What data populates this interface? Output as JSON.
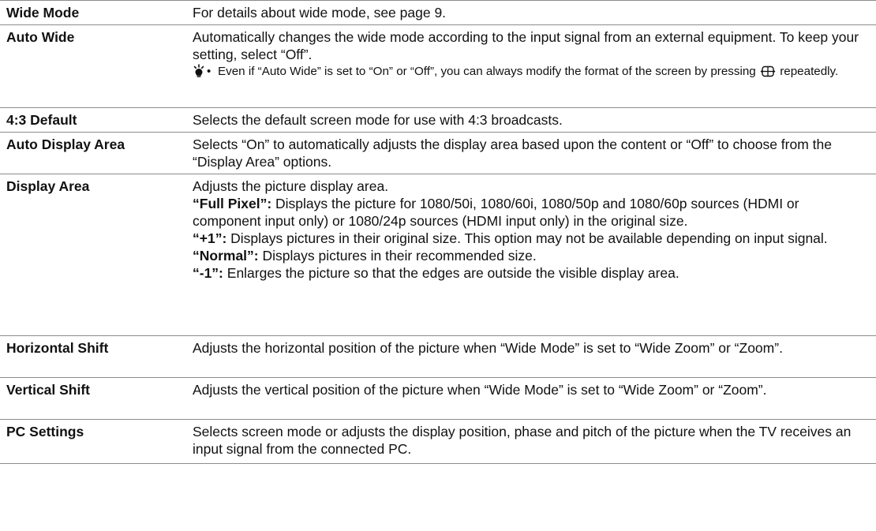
{
  "rows": [
    {
      "term": "Wide Mode",
      "text": "For details about wide mode, see page 9."
    },
    {
      "term": "Auto Wide",
      "text": "Automatically changes the wide mode according to the input signal from an external equipment. To keep your setting, select “Off”.",
      "hint_bullet": "•",
      "hint_before": "Even if “Auto Wide” is set to “On” or “Off”, you can always modify the format of the screen by pressing",
      "hint_after": "repeatedly."
    },
    {
      "term": "4:3 Default",
      "text": "Selects the default screen mode for use with 4:3 broadcasts."
    },
    {
      "term": "Auto Display Area",
      "text": "Selects “On” to automatically adjusts the display area based upon the content or “Off” to choose from the “Display Area” options."
    },
    {
      "term": "Display Area",
      "text": "Adjusts the picture display area.",
      "options": [
        {
          "label": "“Full Pixel”:",
          "text": "Displays the picture for 1080/50i, 1080/60i, 1080/50p and 1080/60p sources (HDMI or component input only) or 1080/24p sources (HDMI input only) in the original size."
        },
        {
          "label": "“+1”:",
          "text": "Displays pictures in their original size. This option may not be available depending on input signal."
        },
        {
          "label": "“Normal”:",
          "text": "Displays pictures in their recommended size."
        },
        {
          "label": "“-1”:",
          "text": "Enlarges the picture so that the edges are outside the visible display area."
        }
      ]
    },
    {
      "term": "Horizontal Shift",
      "text": "Adjusts the horizontal position of the picture when “Wide Mode” is set to “Wide Zoom” or “Zoom”."
    },
    {
      "term": "Vertical Shift",
      "text": "Adjusts the vertical position of the picture when “Wide Mode” is set to “Wide Zoom” or “Zoom”."
    },
    {
      "term": "PC Settings",
      "text": "Selects screen mode or adjusts the display position, phase and pitch of the picture when the TV receives an input signal from the connected PC."
    }
  ],
  "icons": {
    "hint": "lightbulb-hint-icon",
    "wide_button": "wide-mode-button-icon"
  },
  "colors": {
    "rule": "#8c8c8c",
    "text": "#111111"
  }
}
